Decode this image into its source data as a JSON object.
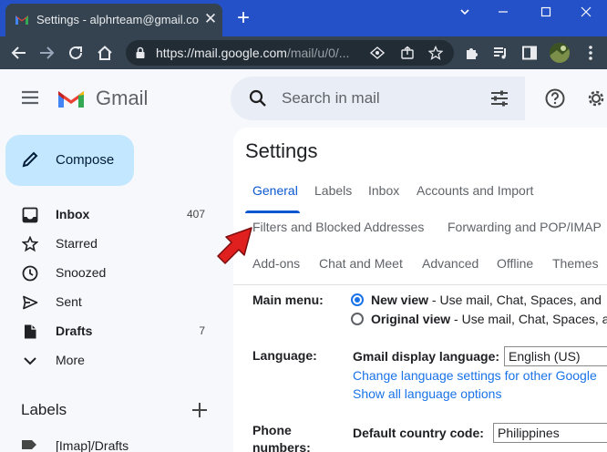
{
  "browser": {
    "tab_title": "Settings - alphrteam@gmail.com",
    "tab_close": "✕",
    "new_tab": "+",
    "url_host": "https://mail.google.com",
    "url_path": "/mail/u/0/..."
  },
  "header": {
    "logo_text": "Gmail",
    "search_placeholder": "Search in mail"
  },
  "sidebar": {
    "compose_label": "Compose",
    "items": [
      {
        "label": "Inbox",
        "count": "407",
        "icon": "inbox-icon"
      },
      {
        "label": "Starred",
        "count": "",
        "icon": "star-icon"
      },
      {
        "label": "Snoozed",
        "count": "",
        "icon": "clock-icon"
      },
      {
        "label": "Sent",
        "count": "",
        "icon": "send-icon"
      },
      {
        "label": "Drafts",
        "count": "7",
        "icon": "draft-icon"
      },
      {
        "label": "More",
        "count": "",
        "icon": "chevron-down-icon"
      }
    ],
    "labels_heading": "Labels",
    "labels": [
      {
        "label": "[Imap]/Drafts",
        "icon": "label-icon"
      }
    ]
  },
  "settings": {
    "title": "Settings",
    "tabs_row1": [
      "General",
      "Labels",
      "Inbox",
      "Accounts and Import"
    ],
    "tabs_row2": [
      "Filters and Blocked Addresses",
      "Forwarding and POP/IMAP"
    ],
    "tabs_row3": [
      "Add-ons",
      "Chat and Meet",
      "Advanced",
      "Offline",
      "Themes"
    ],
    "active_tab": "General",
    "main_menu": {
      "label": "Main menu:",
      "option1_title": "New view",
      "option1_desc": " - Use mail, Chat, Spaces, and",
      "option2_title": "Original view",
      "option2_desc": " - Use mail, Chat, Spaces, a"
    },
    "language": {
      "label": "Language:",
      "field_label": "Gmail display language:",
      "value": "English (US)",
      "link1": "Change language settings for other Google",
      "link2": "Show all language options"
    },
    "phone": {
      "label_line1": "Phone",
      "label_line2": "numbers:",
      "field_label": "Default country code:",
      "value": "Philippines"
    }
  },
  "colors": {
    "titlebar": "#2451c8",
    "toolbar": "#34434f",
    "compose": "#c2e7ff",
    "accent": "#0b57d0",
    "arrow": "#e01f1f"
  }
}
